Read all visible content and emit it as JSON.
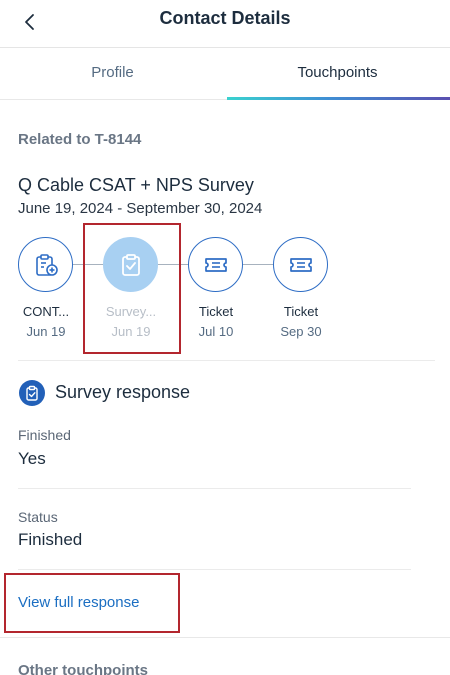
{
  "header": {
    "title": "Contact Details",
    "back_icon": "chevron-left-icon"
  },
  "tabs": [
    {
      "label": "Profile",
      "active": false
    },
    {
      "label": "Touchpoints",
      "active": true
    }
  ],
  "related_label": "Related to T-8144",
  "survey": {
    "title": "Q Cable CSAT + NPS Survey",
    "dates": "June 19, 2024 - September 30, 2024"
  },
  "touchpoints": [
    {
      "label": "CONT...",
      "date": "Jun 19",
      "icon": "clipboard-add-icon",
      "active": false
    },
    {
      "label": "Survey...",
      "date": "Jun 19",
      "icon": "clipboard-check-icon",
      "active": true
    },
    {
      "label": "Ticket",
      "date": "Jul 10",
      "icon": "ticket-icon",
      "active": false
    },
    {
      "label": "Ticket",
      "date": "Sep 30",
      "icon": "ticket-icon",
      "active": false
    }
  ],
  "response": {
    "title": "Survey response",
    "icon": "clipboard-check-icon",
    "fields": [
      {
        "label": "Finished",
        "value": "Yes"
      },
      {
        "label": "Status",
        "value": "Finished"
      }
    ],
    "link": "View full response"
  },
  "other_touchpoints_label": "Other touchpoints",
  "colors": {
    "accent": "#2e6dc5",
    "link": "#1b6ec2",
    "active_touchpoint": "#a8d0f2",
    "highlight_border": "#b3262e"
  }
}
